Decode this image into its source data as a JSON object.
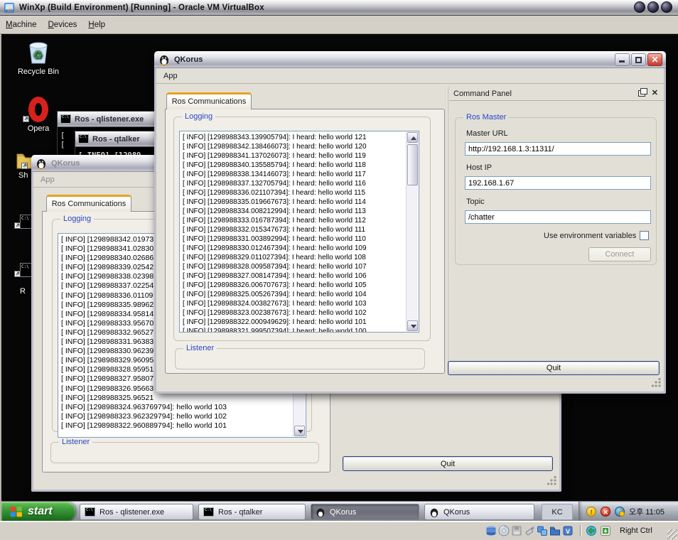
{
  "colors": {
    "tab_accent_orange": "#e8a21e",
    "group_label_blue": "#2b46c8",
    "start_green": "#2f8f2f",
    "close_red": "#c03a2c",
    "desktop_black": "#060606"
  },
  "vbox": {
    "title": "WinXp (Build Environment) [Running] - Oracle VM VirtualBox",
    "menus": [
      "Machine",
      "Devices",
      "Help"
    ],
    "host_key": "Right Ctrl"
  },
  "desktop": {
    "recycle_bin_label": "Recycle Bin",
    "opera_label": "Opera",
    "partial_icon_label_1": "Sh",
    "partial_icon_label_2": "R"
  },
  "console_listener": {
    "title": "Ros - qlistener.exe",
    "content_fragment": [
      "[",
      "["
    ]
  },
  "console_talker": {
    "title": "Ros - qtalker",
    "content_fragment": "[ INFO] [12989"
  },
  "back_window": {
    "title": "QKorus",
    "menu_app": "App",
    "tab_label": "Ros Communications",
    "logging_label": "Logging",
    "listener_label": "Listener",
    "quit_label": "Quit",
    "log_lines": [
      "[ INFO] [1298988342.01973",
      "[ INFO] [1298988341.02830",
      "[ INFO] [1298988340.02686",
      "[ INFO] [1298988339.02542",
      "[ INFO] [1298988338.02398",
      "[ INFO] [1298988337.02254",
      "[ INFO] [1298988336.01109",
      "[ INFO] [1298988335.98962",
      "[ INFO] [1298988334.95814",
      "[ INFO] [1298988333.95670",
      "[ INFO] [1298988332.96527",
      "[ INFO] [1298988331.96383",
      "[ INFO] [1298988330.96239",
      "[ INFO] [1298988329.96095",
      "[ INFO] [1298988328.95951",
      "[ INFO] [1298988327.95807",
      "[ INFO] [1298988326.95663",
      "[ INFO] [1298988325.96521",
      "[ INFO] [1298988324.963769794]: hello world 103",
      "[ INFO] [1298988323.962329794]: hello world 102",
      "[ INFO] [1298988322.960889794]: hello world 101"
    ]
  },
  "front_window": {
    "title": "QKorus",
    "menu_app": "App",
    "tab_label": "Ros Communications",
    "logging_label": "Logging",
    "listener_label": "Listener",
    "quit_label": "Quit",
    "log_lines": [
      "[ INFO] [1298988343.139905794]: I heard: hello world 121",
      "[ INFO] [1298988342.138466073]: I heard: hello world 120",
      "[ INFO] [1298988341.137026073]: I heard: hello world 119",
      "[ INFO] [1298988340.135585794]: I heard: hello world 118",
      "[ INFO] [1298988338.134146073]: I heard: hello world 117",
      "[ INFO] [1298988337.132705794]: I heard: hello world 116",
      "[ INFO] [1298988336.021107394]: I heard: hello world 115",
      "[ INFO] [1298988335.019667673]: I heard: hello world 114",
      "[ INFO] [1298988334.008212994]: I heard: hello world 113",
      "[ INFO] [1298988333.016787394]: I heard: hello world 112",
      "[ INFO] [1298988332.015347673]: I heard: hello world 111",
      "[ INFO] [1298988331.003892994]: I heard: hello world 110",
      "[ INFO] [1298988330.012467394]: I heard: hello world 109",
      "[ INFO] [1298988329.011027394]: I heard: hello world 108",
      "[ INFO] [1298988328.009587394]: I heard: hello world 107",
      "[ INFO] [1298988327.008147394]: I heard: hello world 106",
      "[ INFO] [1298988326.006707673]: I heard: hello world 105",
      "[ INFO] [1298988325.005267394]: I heard: hello world 104",
      "[ INFO] [1298988324.003827673]: I heard: hello world 103",
      "[ INFO] [1298988323.002387673]: I heard: hello world 102",
      "[ INFO] [1298988322.000949629]: I heard: hello world 101",
      "[ INFO] [1298988321.999507394]: I heard: hello world 100"
    ],
    "command_panel": {
      "title": "Command Panel",
      "ros_master_label": "Ros Master",
      "master_url_label": "Master URL",
      "master_url_value": "http://192.168.1.3:11311/",
      "host_ip_label": "Host IP",
      "host_ip_value": "192.168.1.67",
      "topic_label": "Topic",
      "topic_value": "/chatter",
      "env_checkbox_label": "Use environment variables",
      "connect_label": "Connect"
    }
  },
  "taskbar": {
    "start_label": "start",
    "tasks": [
      "Ros - qlistener.exe",
      "Ros - qtalker",
      "QKorus",
      "QKorus"
    ],
    "lang_indicator": "KC",
    "clock": "오후 11:05"
  }
}
